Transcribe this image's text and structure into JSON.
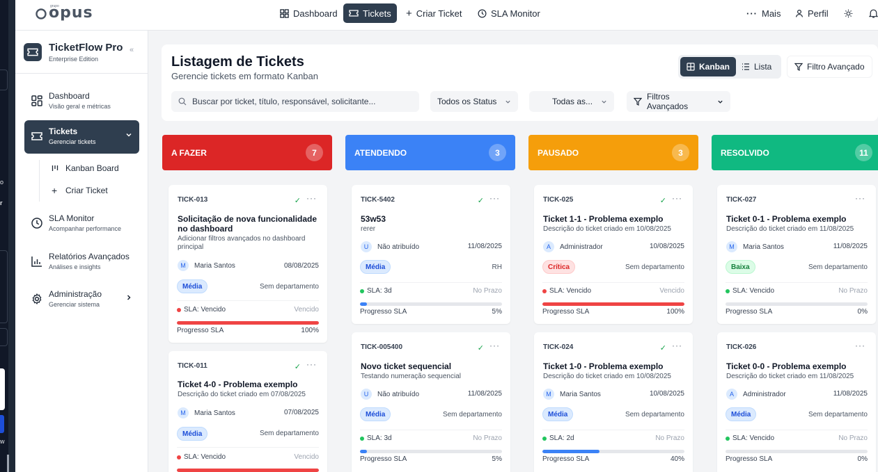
{
  "topnav": {
    "logo": "opus",
    "logo_small": "grupo",
    "items": [
      {
        "label": "Dashboard",
        "icon": "grid-icon"
      },
      {
        "label": "Tickets",
        "icon": "ticket-icon",
        "active": true
      },
      {
        "label": "Criar Ticket",
        "icon": "plus-icon"
      },
      {
        "label": "SLA Monitor",
        "icon": "clock-icon"
      }
    ],
    "more": "Mais",
    "profile": "Perfil"
  },
  "sidebar": {
    "title": "TicketFlow Pro",
    "subtitle": "Enterprise Edition",
    "items": [
      {
        "title": "Dashboard",
        "subtitle": "Visão geral e métricas"
      },
      {
        "title": "Tickets",
        "subtitle": "Gerenciar tickets"
      },
      {
        "title": "SLA Monitor",
        "subtitle": "Acompanhar performance"
      },
      {
        "title": "Relatórios Avançados",
        "subtitle": "Análises e insights"
      },
      {
        "title": "Administração",
        "subtitle": "Gerenciar sistema"
      }
    ],
    "subitems": [
      {
        "label": "Kanban Board"
      },
      {
        "label": "Criar Ticket"
      }
    ]
  },
  "header": {
    "title": "Listagem de Tickets",
    "subtitle": "Gerencie tickets em formato Kanban",
    "view_kanban": "Kanban",
    "view_list": "Lista",
    "advanced_filter": "Filtro Avançado",
    "search_placeholder": "Buscar por ticket, título, responsável, solicitante...",
    "status_select": "Todos os Status",
    "all_select": "Todas as...",
    "filters": "Filtros Avançados"
  },
  "columns": [
    {
      "name": "A FAZER",
      "count": "7",
      "color": "#dc2626",
      "cards": [
        {
          "id": "TICK-013",
          "title": "Solicitação de nova funcionalidade no dashboard",
          "desc": "Adicionar filtros avançados no dashboard principal",
          "assignee": "Maria Santos",
          "avatar": "M",
          "date": "08/08/2025",
          "priority": "Média",
          "dept": "Sem departamento",
          "sla": "SLA: Vencido",
          "sla_state": "Vencido",
          "progress_label": "Progresso SLA",
          "progress": "100%",
          "progress_value": 100
        },
        {
          "id": "TICK-011",
          "title": "Ticket 4-0 - Problema exemplo",
          "desc": "Descrição do ticket criado em 07/08/2025",
          "assignee": "Maria Santos",
          "avatar": "M",
          "date": "07/08/2025",
          "priority": "Média",
          "dept": "Sem departamento",
          "sla": "SLA: Vencido",
          "sla_state": "Vencido",
          "progress_label": "",
          "progress": "",
          "progress_value": 100
        }
      ]
    },
    {
      "name": "ATENDENDO",
      "count": "3",
      "color": "#3b82f6",
      "cards": [
        {
          "id": "TICK-5402",
          "title": "53w53",
          "desc": "rerer",
          "assignee": "Não atribuído",
          "avatar": "U",
          "date": "11/08/2025",
          "priority": "Média",
          "dept": "RH",
          "sla": "SLA: 3d",
          "sla_state": "No Prazo",
          "progress_label": "Progresso SLA",
          "progress": "5%",
          "progress_value": 5
        },
        {
          "id": "TICK-005400",
          "title": "Novo ticket sequencial",
          "desc": "Testando numeração sequencial",
          "assignee": "Não atribuído",
          "avatar": "U",
          "date": "11/08/2025",
          "priority": "Média",
          "dept": "Sem departamento",
          "sla": "SLA: 3d",
          "sla_state": "No Prazo",
          "progress_label": "Progresso SLA",
          "progress": "5%",
          "progress_value": 5
        }
      ]
    },
    {
      "name": "PAUSADO",
      "count": "3",
      "color": "#f59e0b",
      "cards": [
        {
          "id": "TICK-025",
          "title": "Ticket 1-1 - Problema exemplo",
          "desc": "Descrição do ticket criado em 10/08/2025",
          "assignee": "Administrador",
          "avatar": "A",
          "date": "10/08/2025",
          "priority": "Crítica",
          "dept": "Sem departamento",
          "sla": "SLA: Vencido",
          "sla_state": "Vencido",
          "progress_label": "Progresso SLA",
          "progress": "100%",
          "progress_value": 100
        },
        {
          "id": "TICK-024",
          "title": "Ticket 1-0 - Problema exemplo",
          "desc": "Descrição do ticket criado em 10/08/2025",
          "assignee": "Maria Santos",
          "avatar": "M",
          "date": "10/08/2025",
          "priority": "Média",
          "dept": "Sem departamento",
          "sla": "SLA: 2d",
          "sla_state": "No Prazo",
          "progress_label": "Progresso SLA",
          "progress": "40%",
          "progress_value": 40
        }
      ]
    },
    {
      "name": "RESOLVIDO",
      "count": "11",
      "color": "#10b981",
      "cards": [
        {
          "id": "TICK-027",
          "title": "Ticket 0-1 - Problema exemplo",
          "desc": "Descrição do ticket criado em 11/08/2025",
          "assignee": "Maria Santos",
          "avatar": "M",
          "date": "11/08/2025",
          "priority": "Baixa",
          "dept": "Sem departamento",
          "sla": "SLA: Vencido",
          "sla_state": "No Prazo",
          "progress_label": "Progresso SLA",
          "progress": "0%",
          "progress_value": 0
        },
        {
          "id": "TICK-026",
          "title": "Ticket 0-0 - Problema exemplo",
          "desc": "Descrição do ticket criado em 11/08/2025",
          "assignee": "Administrador",
          "avatar": "A",
          "date": "11/08/2025",
          "priority": "Média",
          "dept": "Sem departamento",
          "sla": "SLA: Vencido",
          "sla_state": "No Prazo",
          "progress_label": "Progresso SLA",
          "progress": "0%",
          "progress_value": 0
        }
      ]
    }
  ],
  "edge_text": [
    "o",
    "r",
    "w"
  ]
}
